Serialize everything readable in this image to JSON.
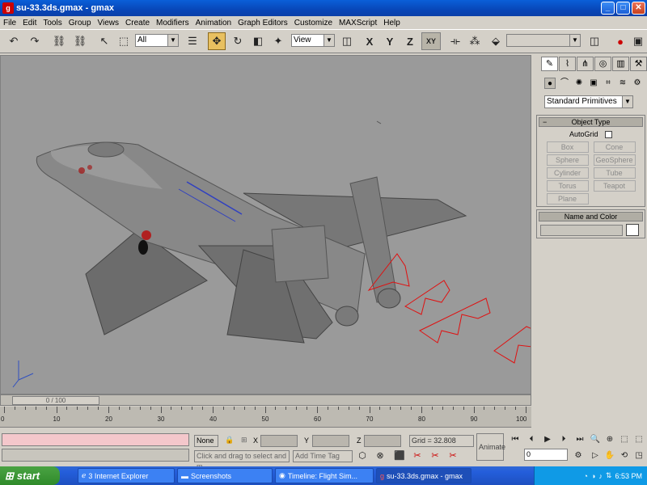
{
  "window": {
    "title": "su-33.3ds.gmax - gmax",
    "app_icon": "gmax-icon"
  },
  "menu": [
    "File",
    "Edit",
    "Tools",
    "Group",
    "Views",
    "Create",
    "Modifiers",
    "Animation",
    "Graph Editors",
    "Customize",
    "MAXScript",
    "Help"
  ],
  "toolbar": {
    "selection_filter": "All",
    "reference_coord": "View",
    "axis_x": "X",
    "axis_y": "Y",
    "axis_z": "Z",
    "axis_xy": "XY"
  },
  "command_panel": {
    "dropdown": "Standard Primitives",
    "object_type_title": "Object Type",
    "autogrid_label": "AutoGrid",
    "buttons": [
      "Box",
      "Cone",
      "Sphere",
      "GeoSphere",
      "Cylinder",
      "Tube",
      "Torus",
      "Teapot",
      "Plane"
    ],
    "name_color_title": "Name and Color"
  },
  "timeline": {
    "slider_label": "0 / 100",
    "ruler_labels": [
      "0",
      "10",
      "20",
      "30",
      "40",
      "50",
      "60",
      "70",
      "80",
      "90",
      "100"
    ]
  },
  "status": {
    "none_label": "None",
    "x_label": "X",
    "y_label": "Y",
    "z_label": "Z",
    "grid": "Grid = 32.808",
    "prompt": "Click and drag to select and m",
    "add_time_tag": "Add Time Tag",
    "animate": "Animate",
    "frame": "0"
  },
  "taskbar": {
    "start": "start",
    "tasks": [
      {
        "label": "3 Internet Explorer",
        "icon": "ie-icon"
      },
      {
        "label": "Screenshots",
        "icon": "folder-icon"
      },
      {
        "label": "Timeline: Flight Sim...",
        "icon": "app-icon"
      },
      {
        "label": "su-33.3ds.gmax - gmax",
        "icon": "gmax-icon"
      }
    ],
    "clock": "6:53 PM"
  }
}
